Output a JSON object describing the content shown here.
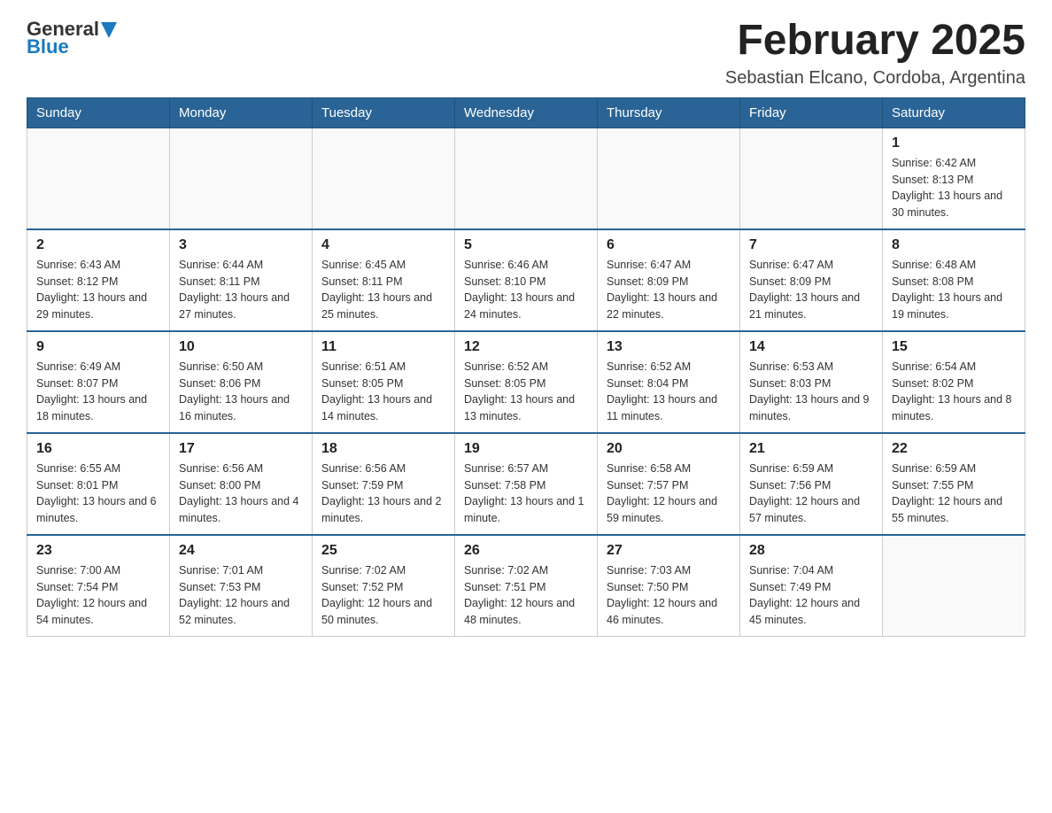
{
  "logo": {
    "general": "General",
    "blue": "Blue"
  },
  "title": "February 2025",
  "subtitle": "Sebastian Elcano, Cordoba, Argentina",
  "weekdays": [
    "Sunday",
    "Monday",
    "Tuesday",
    "Wednesday",
    "Thursday",
    "Friday",
    "Saturday"
  ],
  "weeks": [
    [
      {
        "day": "",
        "info": ""
      },
      {
        "day": "",
        "info": ""
      },
      {
        "day": "",
        "info": ""
      },
      {
        "day": "",
        "info": ""
      },
      {
        "day": "",
        "info": ""
      },
      {
        "day": "",
        "info": ""
      },
      {
        "day": "1",
        "info": "Sunrise: 6:42 AM\nSunset: 8:13 PM\nDaylight: 13 hours and 30 minutes."
      }
    ],
    [
      {
        "day": "2",
        "info": "Sunrise: 6:43 AM\nSunset: 8:12 PM\nDaylight: 13 hours and 29 minutes."
      },
      {
        "day": "3",
        "info": "Sunrise: 6:44 AM\nSunset: 8:11 PM\nDaylight: 13 hours and 27 minutes."
      },
      {
        "day": "4",
        "info": "Sunrise: 6:45 AM\nSunset: 8:11 PM\nDaylight: 13 hours and 25 minutes."
      },
      {
        "day": "5",
        "info": "Sunrise: 6:46 AM\nSunset: 8:10 PM\nDaylight: 13 hours and 24 minutes."
      },
      {
        "day": "6",
        "info": "Sunrise: 6:47 AM\nSunset: 8:09 PM\nDaylight: 13 hours and 22 minutes."
      },
      {
        "day": "7",
        "info": "Sunrise: 6:47 AM\nSunset: 8:09 PM\nDaylight: 13 hours and 21 minutes."
      },
      {
        "day": "8",
        "info": "Sunrise: 6:48 AM\nSunset: 8:08 PM\nDaylight: 13 hours and 19 minutes."
      }
    ],
    [
      {
        "day": "9",
        "info": "Sunrise: 6:49 AM\nSunset: 8:07 PM\nDaylight: 13 hours and 18 minutes."
      },
      {
        "day": "10",
        "info": "Sunrise: 6:50 AM\nSunset: 8:06 PM\nDaylight: 13 hours and 16 minutes."
      },
      {
        "day": "11",
        "info": "Sunrise: 6:51 AM\nSunset: 8:05 PM\nDaylight: 13 hours and 14 minutes."
      },
      {
        "day": "12",
        "info": "Sunrise: 6:52 AM\nSunset: 8:05 PM\nDaylight: 13 hours and 13 minutes."
      },
      {
        "day": "13",
        "info": "Sunrise: 6:52 AM\nSunset: 8:04 PM\nDaylight: 13 hours and 11 minutes."
      },
      {
        "day": "14",
        "info": "Sunrise: 6:53 AM\nSunset: 8:03 PM\nDaylight: 13 hours and 9 minutes."
      },
      {
        "day": "15",
        "info": "Sunrise: 6:54 AM\nSunset: 8:02 PM\nDaylight: 13 hours and 8 minutes."
      }
    ],
    [
      {
        "day": "16",
        "info": "Sunrise: 6:55 AM\nSunset: 8:01 PM\nDaylight: 13 hours and 6 minutes."
      },
      {
        "day": "17",
        "info": "Sunrise: 6:56 AM\nSunset: 8:00 PM\nDaylight: 13 hours and 4 minutes."
      },
      {
        "day": "18",
        "info": "Sunrise: 6:56 AM\nSunset: 7:59 PM\nDaylight: 13 hours and 2 minutes."
      },
      {
        "day": "19",
        "info": "Sunrise: 6:57 AM\nSunset: 7:58 PM\nDaylight: 13 hours and 1 minute."
      },
      {
        "day": "20",
        "info": "Sunrise: 6:58 AM\nSunset: 7:57 PM\nDaylight: 12 hours and 59 minutes."
      },
      {
        "day": "21",
        "info": "Sunrise: 6:59 AM\nSunset: 7:56 PM\nDaylight: 12 hours and 57 minutes."
      },
      {
        "day": "22",
        "info": "Sunrise: 6:59 AM\nSunset: 7:55 PM\nDaylight: 12 hours and 55 minutes."
      }
    ],
    [
      {
        "day": "23",
        "info": "Sunrise: 7:00 AM\nSunset: 7:54 PM\nDaylight: 12 hours and 54 minutes."
      },
      {
        "day": "24",
        "info": "Sunrise: 7:01 AM\nSunset: 7:53 PM\nDaylight: 12 hours and 52 minutes."
      },
      {
        "day": "25",
        "info": "Sunrise: 7:02 AM\nSunset: 7:52 PM\nDaylight: 12 hours and 50 minutes."
      },
      {
        "day": "26",
        "info": "Sunrise: 7:02 AM\nSunset: 7:51 PM\nDaylight: 12 hours and 48 minutes."
      },
      {
        "day": "27",
        "info": "Sunrise: 7:03 AM\nSunset: 7:50 PM\nDaylight: 12 hours and 46 minutes."
      },
      {
        "day": "28",
        "info": "Sunrise: 7:04 AM\nSunset: 7:49 PM\nDaylight: 12 hours and 45 minutes."
      },
      {
        "day": "",
        "info": ""
      }
    ]
  ]
}
